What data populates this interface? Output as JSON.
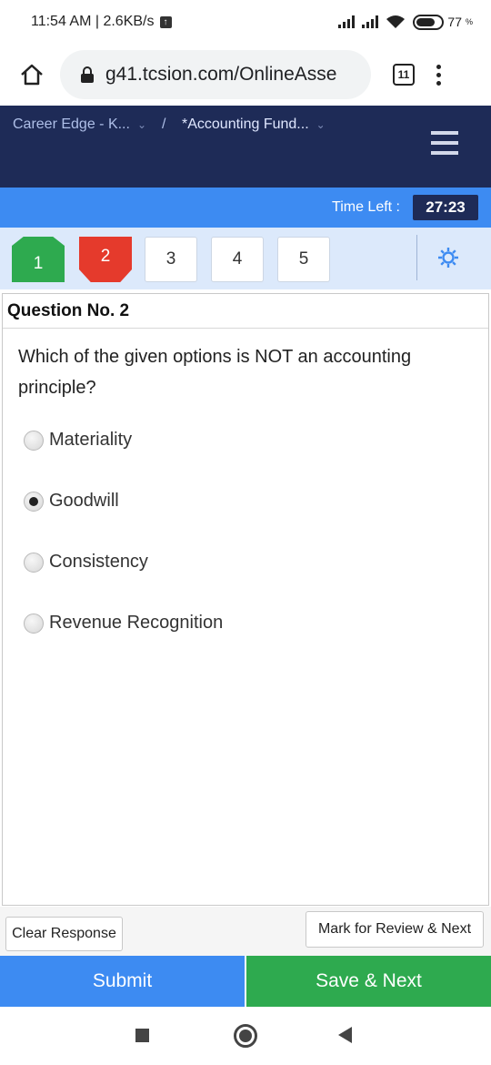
{
  "status_bar": {
    "time_speed": "11:54 AM | 2.6KB/s",
    "battery_percent": "77",
    "battery_unit": "%"
  },
  "browser": {
    "url": "g41.tcsion.com/OnlineAsse",
    "tab_count": "11"
  },
  "header": {
    "breadcrumb_1": "Career Edge - K...",
    "separator": "/",
    "breadcrumb_2": "*Accounting Fund..."
  },
  "timer": {
    "label": "Time Left :",
    "value": "27:23"
  },
  "palette": {
    "questions": [
      {
        "number": "1",
        "state": "answered"
      },
      {
        "number": "2",
        "state": "not-answered"
      },
      {
        "number": "3",
        "state": "not-visited"
      },
      {
        "number": "4",
        "state": "not-visited"
      },
      {
        "number": "5",
        "state": "not-visited"
      }
    ]
  },
  "question": {
    "heading": "Question No. 2",
    "text": "Which of the given options is NOT an accounting principle?",
    "options": [
      {
        "label": "Materiality",
        "selected": false
      },
      {
        "label": "Goodwill",
        "selected": true
      },
      {
        "label": "Consistency",
        "selected": false
      },
      {
        "label": "Revenue Recognition",
        "selected": false
      }
    ]
  },
  "actions": {
    "clear_label": "Clear Response",
    "mark_label": "Mark for Review & Next",
    "submit_label": "Submit",
    "save_label": "Save & Next"
  },
  "colors": {
    "header_navy": "#1e2b57",
    "accent_blue": "#3d8bf2",
    "answered_green": "#2eaa4f",
    "not_answered_red": "#e53a2c",
    "palette_bg": "#dce9fb"
  },
  "icons": [
    "upload-icon",
    "signal-icon",
    "wifi-icon",
    "battery-icon",
    "home-icon",
    "lock-icon",
    "tab-switcher-icon",
    "more-menu-icon",
    "chevron-down-icon",
    "hamburger-menu-icon",
    "gear-icon",
    "radio-icon",
    "recents-icon",
    "home-nav-icon",
    "back-icon"
  ]
}
